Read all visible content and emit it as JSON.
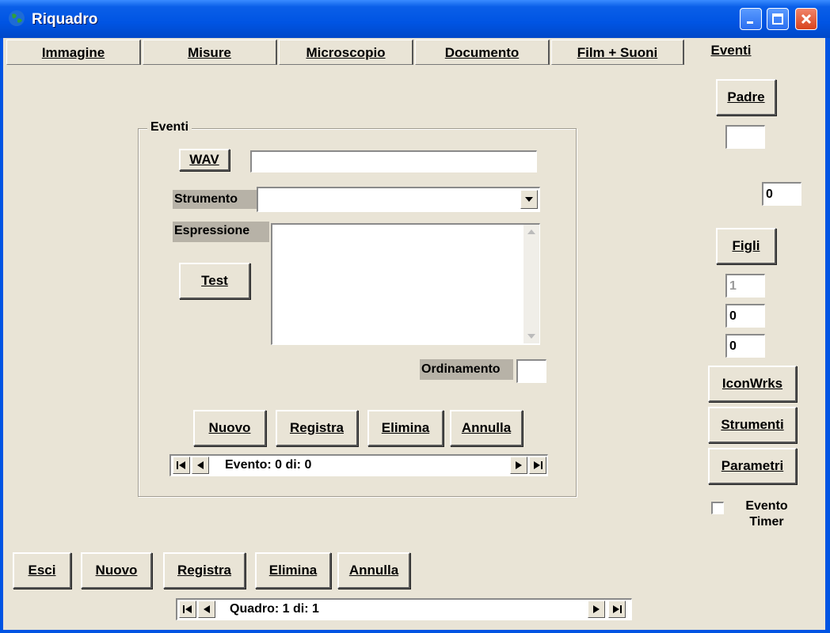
{
  "window": {
    "title": "Riquadro"
  },
  "tabs": [
    {
      "label": "Immagine"
    },
    {
      "label": "Misure"
    },
    {
      "label": "Microscopio"
    },
    {
      "label": "Documento"
    },
    {
      "label": "Film + Suoni"
    },
    {
      "label": "Eventi"
    }
  ],
  "eventi": {
    "group_title": "Eventi",
    "wav_label": "WAV",
    "wav_value": "",
    "strumento_label": "Strumento",
    "strumento_value": "",
    "espressione_label": "Espressione",
    "espressione_value": "",
    "test_label": "Test",
    "ordinamento_label": "Ordinamento",
    "ordinamento_value": "",
    "buttons": {
      "nuovo": "Nuovo",
      "registra": "Registra",
      "elimina": "Elimina",
      "annulla": "Annulla"
    },
    "nav_text": "Evento: 0 di: 0"
  },
  "right_panel": {
    "padre_label": "Padre",
    "padre_value": "",
    "count_value": "0",
    "figli_label": "Figli",
    "figli_values": [
      "1",
      "0",
      "0"
    ],
    "iconwrks_label": "IconWrks",
    "strumenti_label": "Strumenti",
    "parametri_label": "Parametri",
    "evento_timer_label": "Evento Timer",
    "evento_timer_checked": false
  },
  "bottom": {
    "buttons": {
      "esci": "Esci",
      "nuovo": "Nuovo",
      "registra": "Registra",
      "elimina": "Elimina",
      "annulla": "Annulla"
    },
    "nav_text": "Quadro: 1 di: 1"
  },
  "colors": {
    "titlebar": "#0054e3",
    "face": "#e9e4d6",
    "close": "#d8431e"
  }
}
